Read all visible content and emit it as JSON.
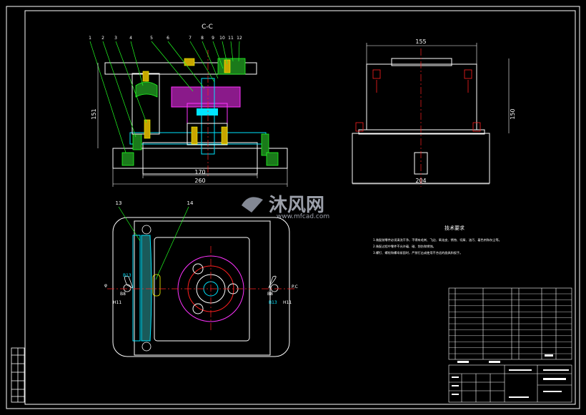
{
  "sheet": {
    "section_label": "C-C",
    "part_numbers": [
      "1",
      "2",
      "3",
      "4",
      "5",
      "6",
      "7",
      "8",
      "9",
      "10",
      "11",
      "12"
    ],
    "plan_part_numbers": [
      "13",
      "14"
    ],
    "dimensions": {
      "base_inner": "170",
      "base_overall": "260",
      "height_left": "151",
      "top_width": "155",
      "height_right": "150",
      "right_base": "204"
    },
    "plan_labels": {
      "b13_left": "B13",
      "b13_right": "B13",
      "b8_left": "B8",
      "b8_right": "B8",
      "h11_left": "H11",
      "h11_right": "H11",
      "phi_left": "φ",
      "mark_right": "P.C"
    }
  },
  "watermark": {
    "brand_cn": "沐风网",
    "url": "www.mfcad.com"
  },
  "notes": {
    "title": "技术要求",
    "lines": [
      "1.装配前零件必须清洗干净，不得有毛刺、飞边、氧化皮、锈蚀、切屑、油污、着色剂和灰尘等。",
      "2.装配过程中零件不允许磕、碰、划伤和锈蚀。",
      "3.螺钉、螺栓和螺母紧固时，严禁打击或使用不合适的旋具和扳手。"
    ]
  },
  "colors": {
    "outline": "#ffffff",
    "cyan": "#00e5ff",
    "green": "#22ff22",
    "red": "#ff2020",
    "magenta": "#ff33ff",
    "yellow": "#ffff00",
    "watermark": "#b8bcc8"
  }
}
